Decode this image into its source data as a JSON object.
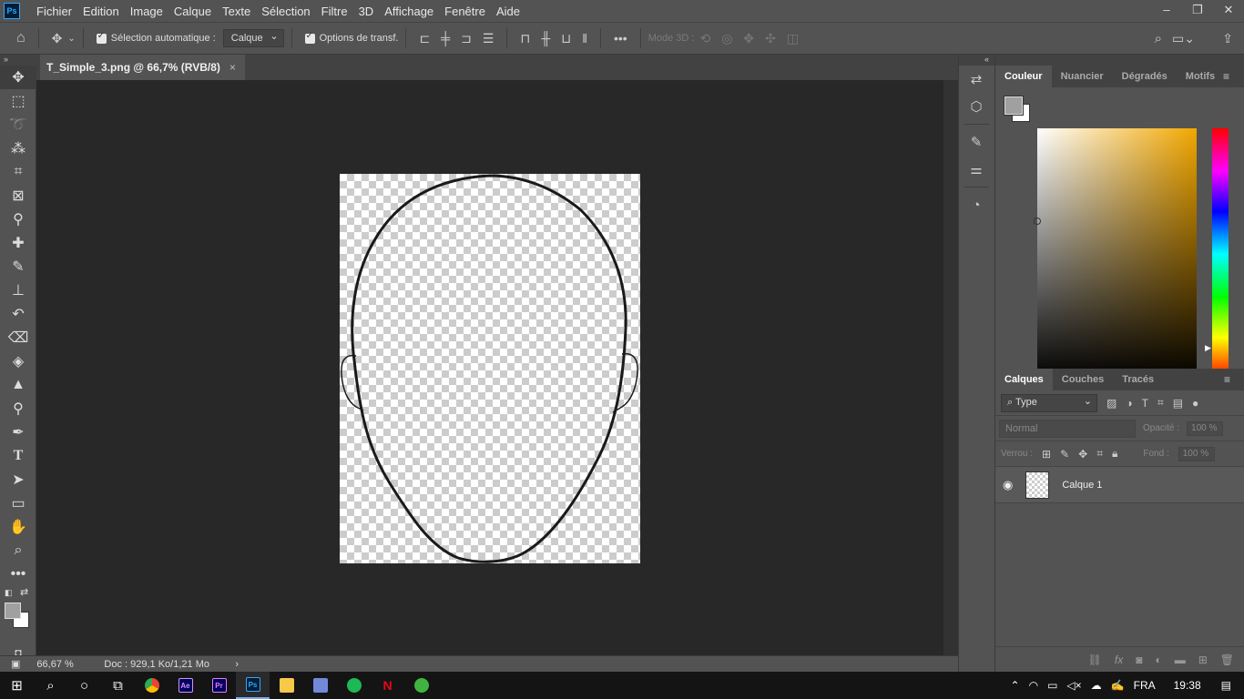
{
  "app": {
    "logo": "Ps"
  },
  "menu": [
    "Fichier",
    "Edition",
    "Image",
    "Calque",
    "Texte",
    "Sélection",
    "Filtre",
    "3D",
    "Affichage",
    "Fenêtre",
    "Aide"
  ],
  "window_controls": {
    "minimize": "–",
    "restore": "❐",
    "close": "✕"
  },
  "options": {
    "auto_select_label": "Sélection automatique :",
    "auto_select_value": "Calque",
    "transform_label": "Options de transf.",
    "mode3d_label": "Mode 3D :",
    "more": "•••"
  },
  "document": {
    "tab_title": "T_Simple_3.png @ 66,7% (RVB/8)",
    "close": "×"
  },
  "status": {
    "zoom": "66,67 %",
    "doc": "Doc : 929,1 Ko/1,21 Mo",
    "arrow": "›"
  },
  "color_panel": {
    "tabs": [
      "Couleur",
      "Nuancier",
      "Dégradés",
      "Motifs"
    ],
    "foreground": "#a0a0a0",
    "background": "#ffffff",
    "hue_color": "#f2a700"
  },
  "layers_panel": {
    "tabs": [
      "Calques",
      "Couches",
      "Tracés"
    ],
    "filter_type": "Type",
    "blend_mode": "Normal",
    "opacity_label": "Opacité :",
    "opacity_value": "100 %",
    "lock_label": "Verrou :",
    "fill_label": "Fond :",
    "fill_value": "100 %",
    "layers": [
      {
        "name": "Calque 1",
        "visible": true
      }
    ]
  },
  "taskbar": {
    "apps": [
      "Chrome",
      "Ae",
      "Pr",
      "Ps",
      "Explorateur",
      "Discord",
      "Spotify",
      "Netflix",
      "Xbox"
    ],
    "language": "FRA",
    "time": "19:38"
  }
}
